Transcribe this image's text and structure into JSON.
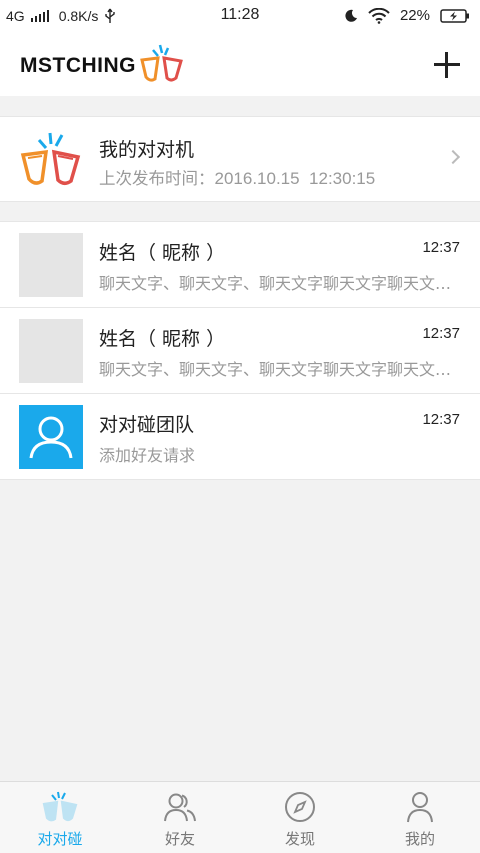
{
  "status_bar": {
    "network": "4G",
    "speed": "0.8K/s",
    "time": "11:28",
    "battery": "22%"
  },
  "header": {
    "logo_text": "MSTCHING"
  },
  "machine": {
    "title": "我的对对机",
    "subtitle_prefix": "上次发布时间：",
    "subtitle_time": "2016.10.15  12:30:15"
  },
  "chats": [
    {
      "name": "姓名（ 昵称 ）",
      "time": "12:37",
      "message": "聊天文字、聊天文字、聊天文字聊天文字聊天文字聊天文字"
    },
    {
      "name": "姓名（ 昵称 ）",
      "time": "12:37",
      "message": "聊天文字、聊天文字、聊天文字聊天文字聊天文字聊天文字"
    },
    {
      "name": "对对碰团队",
      "time": "12:37",
      "message": "添加好友请求"
    }
  ],
  "nav": [
    {
      "label": "对对碰",
      "icon": "duiduipeng-icon",
      "active": true
    },
    {
      "label": "好友",
      "icon": "friends-icon",
      "active": false
    },
    {
      "label": "发现",
      "icon": "compass-icon",
      "active": false
    },
    {
      "label": "我的",
      "icon": "profile-icon",
      "active": false
    }
  ],
  "colors": {
    "accent": "#1aa9eb",
    "orange": "#f0902a",
    "red": "#e0504a",
    "muted_text": "#999999"
  }
}
